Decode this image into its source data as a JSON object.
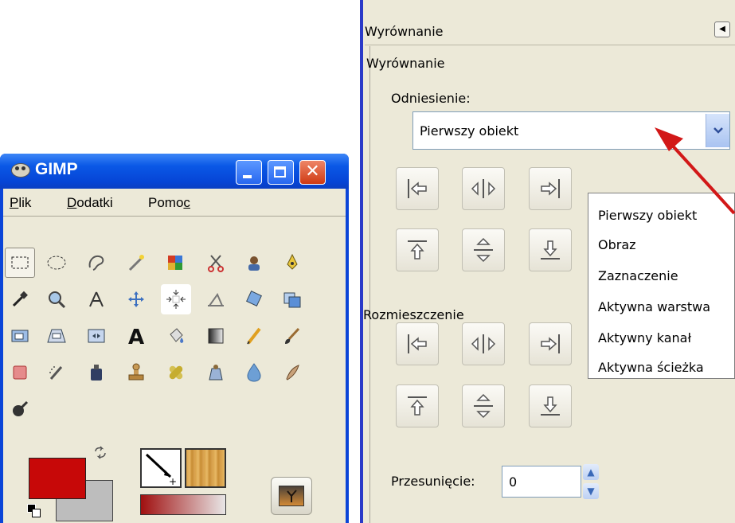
{
  "gimp": {
    "title": "GIMP",
    "menu": [
      {
        "label": "Plik"
      },
      {
        "label": "Dodatki"
      },
      {
        "label": "Pomoc"
      }
    ],
    "close_glyph": "✕"
  },
  "alignment": {
    "dock_title": "Wyrównanie",
    "panel_title": "Wyrównanie",
    "relative_label": "Odniesienie:",
    "relative_value": "Pierwszy obiekt",
    "dropdown_options": [
      "Pierwszy obiekt",
      "Obraz",
      "Zaznaczenie",
      "Aktywna warstwa",
      "Aktywny kanał",
      "Aktywna ścieżka"
    ],
    "distribute_label": "Rozmieszczenie",
    "offset_label": "Przesunięcie:",
    "offset_value": "0"
  },
  "colors": {
    "foreground": "#c70808",
    "background": "#bdbdbd",
    "xp_blue": "#0645d6",
    "arrow_red": "#d21818"
  }
}
